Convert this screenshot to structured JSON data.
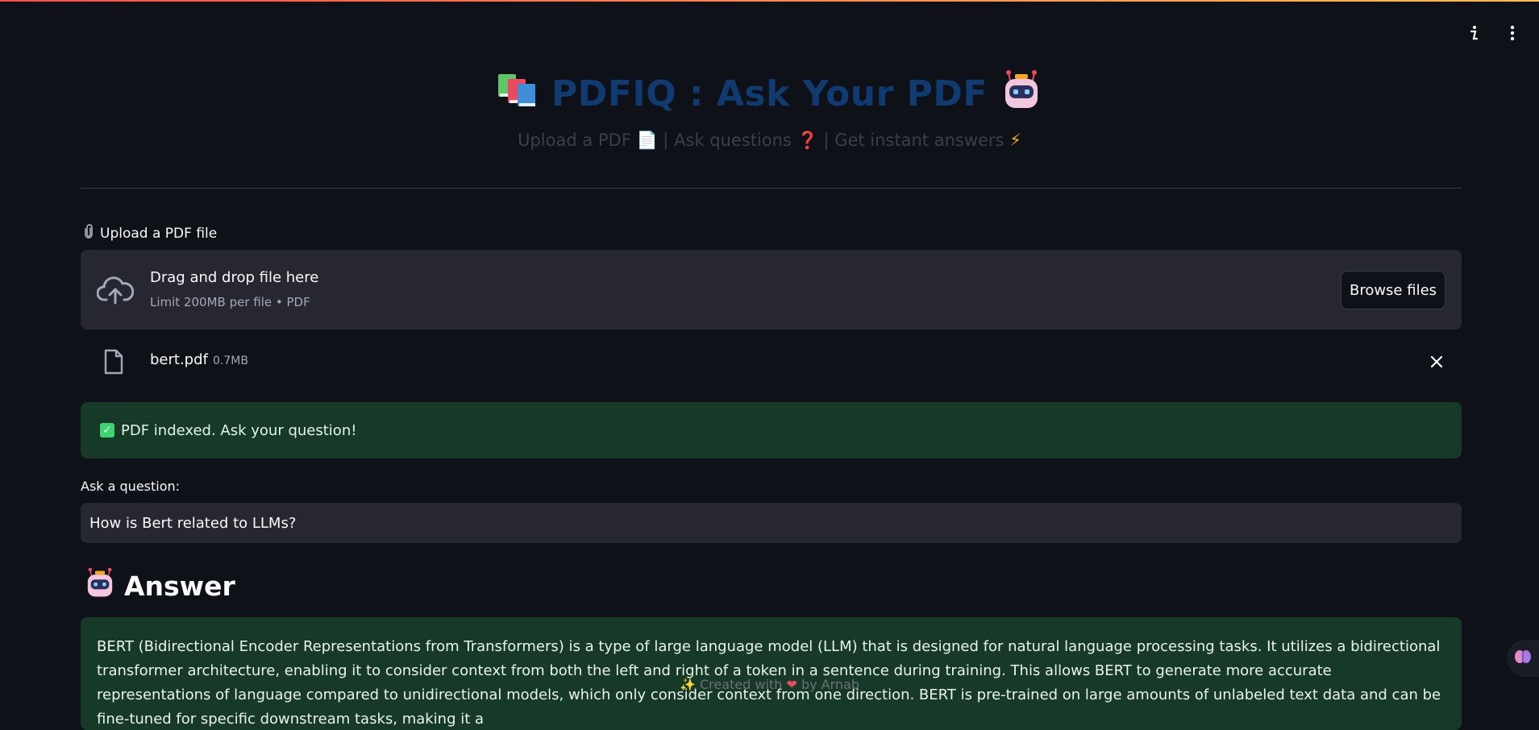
{
  "header": {
    "title": "PDFIQ : Ask Your PDF",
    "subtitle": {
      "part1": "Upload a PDF",
      "sep1": " |",
      "part2": "Ask questions",
      "sep2": " |",
      "part3": "Get instant answers"
    }
  },
  "uploader": {
    "label": "Upload a PDF file",
    "drop_title": "Drag and drop file here",
    "drop_limit": "Limit 200MB per file • PDF",
    "browse_label": "Browse files"
  },
  "file": {
    "name": "bert.pdf",
    "size": "0.7MB"
  },
  "status": {
    "message": "PDF indexed. Ask your question!"
  },
  "question": {
    "label": "Ask a question:",
    "value": "How is Bert related to LLMs?"
  },
  "answer": {
    "heading": "Answer",
    "text": "BERT (Bidirectional Encoder Representations from Transformers) is a type of large language model (LLM) that is designed for natural language processing tasks. It utilizes a bidirectional transformer architecture, enabling it to consider context from both the left and right of a token in a sentence during training. This allows BERT to generate more accurate representations of language compared to unidirectional models, which only consider context from one direction. BERT is pre-trained on large amounts of unlabeled text data and can be fine-tuned for specific downstream tasks, making it a"
  },
  "footer": {
    "text_before": "Created with",
    "text_after": "by Arnab"
  },
  "colors": {
    "background": "#0e1117",
    "title": "#103b70",
    "success_bg": "#173928",
    "input_bg": "#262730"
  },
  "icons": [
    "info-icon",
    "more-vertical-icon",
    "books-icon",
    "robot-icon",
    "page-icon",
    "question-icon",
    "bolt-icon",
    "paperclip-icon",
    "cloud-upload-icon",
    "file-icon",
    "close-icon",
    "checkbox-icon",
    "sparkles-icon",
    "heart-icon",
    "brain-icon"
  ]
}
